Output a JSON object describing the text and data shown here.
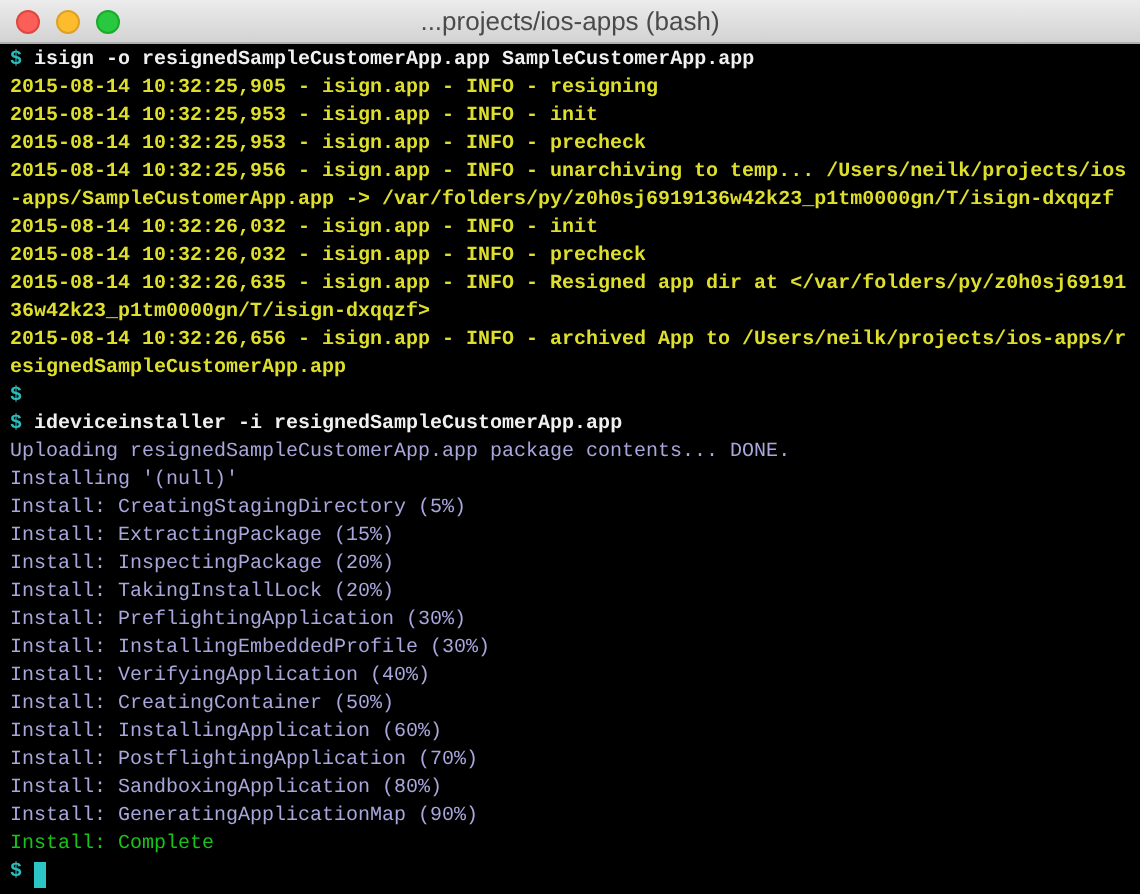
{
  "window": {
    "title": "...projects/ios-apps (bash)"
  },
  "lines": [
    {
      "kind": "prompt",
      "prompt": "$",
      "text": "isign -o resignedSampleCustomerApp.app SampleCustomerApp.app"
    },
    {
      "kind": "log",
      "text": "2015-08-14 10:32:25,905 - isign.app - INFO - resigning"
    },
    {
      "kind": "log",
      "text": "2015-08-14 10:32:25,953 - isign.app - INFO - init"
    },
    {
      "kind": "log",
      "text": "2015-08-14 10:32:25,953 - isign.app - INFO - precheck"
    },
    {
      "kind": "log",
      "text": "2015-08-14 10:32:25,956 - isign.app - INFO - unarchiving to temp... /Users/neilk/projects/ios"
    },
    {
      "kind": "log",
      "text": "-apps/SampleCustomerApp.app -> /var/folders/py/z0h0sj6919136w42k23_p1tm0000gn/T/isign-dxqqzf"
    },
    {
      "kind": "log",
      "text": "2015-08-14 10:32:26,032 - isign.app - INFO - init"
    },
    {
      "kind": "log",
      "text": "2015-08-14 10:32:26,032 - isign.app - INFO - precheck"
    },
    {
      "kind": "log",
      "text": "2015-08-14 10:32:26,635 - isign.app - INFO - Resigned app dir at </var/folders/py/z0h0sj69191"
    },
    {
      "kind": "log",
      "text": "36w42k23_p1tm0000gn/T/isign-dxqqzf>"
    },
    {
      "kind": "log",
      "text": "2015-08-14 10:32:26,656 - isign.app - INFO - archived App to /Users/neilk/projects/ios-apps/r"
    },
    {
      "kind": "log",
      "text": "esignedSampleCustomerApp.app"
    },
    {
      "kind": "prompt",
      "prompt": "$"
    },
    {
      "kind": "prompt",
      "prompt": "$",
      "text": "ideviceinstaller -i resignedSampleCustomerApp.app"
    },
    {
      "kind": "output",
      "text": "Uploading resignedSampleCustomerApp.app package contents... DONE."
    },
    {
      "kind": "output",
      "text": "Installing '(null)'"
    },
    {
      "kind": "output",
      "text": "Install: CreatingStagingDirectory (5%)"
    },
    {
      "kind": "output",
      "text": "Install: ExtractingPackage (15%)"
    },
    {
      "kind": "output",
      "text": "Install: InspectingPackage (20%)"
    },
    {
      "kind": "output",
      "text": "Install: TakingInstallLock (20%)"
    },
    {
      "kind": "output",
      "text": "Install: PreflightingApplication (30%)"
    },
    {
      "kind": "output",
      "text": "Install: InstallingEmbeddedProfile (30%)"
    },
    {
      "kind": "output",
      "text": "Install: VerifyingApplication (40%)"
    },
    {
      "kind": "output",
      "text": "Install: CreatingContainer (50%)"
    },
    {
      "kind": "output",
      "text": "Install: InstallingApplication (60%)"
    },
    {
      "kind": "output",
      "text": "Install: PostflightingApplication (70%)"
    },
    {
      "kind": "output",
      "text": "Install: SandboxingApplication (80%)"
    },
    {
      "kind": "output",
      "text": "Install: GeneratingApplicationMap (90%)"
    },
    {
      "kind": "success",
      "text": "Install: Complete"
    },
    {
      "kind": "cursor",
      "prompt": "$"
    }
  ]
}
